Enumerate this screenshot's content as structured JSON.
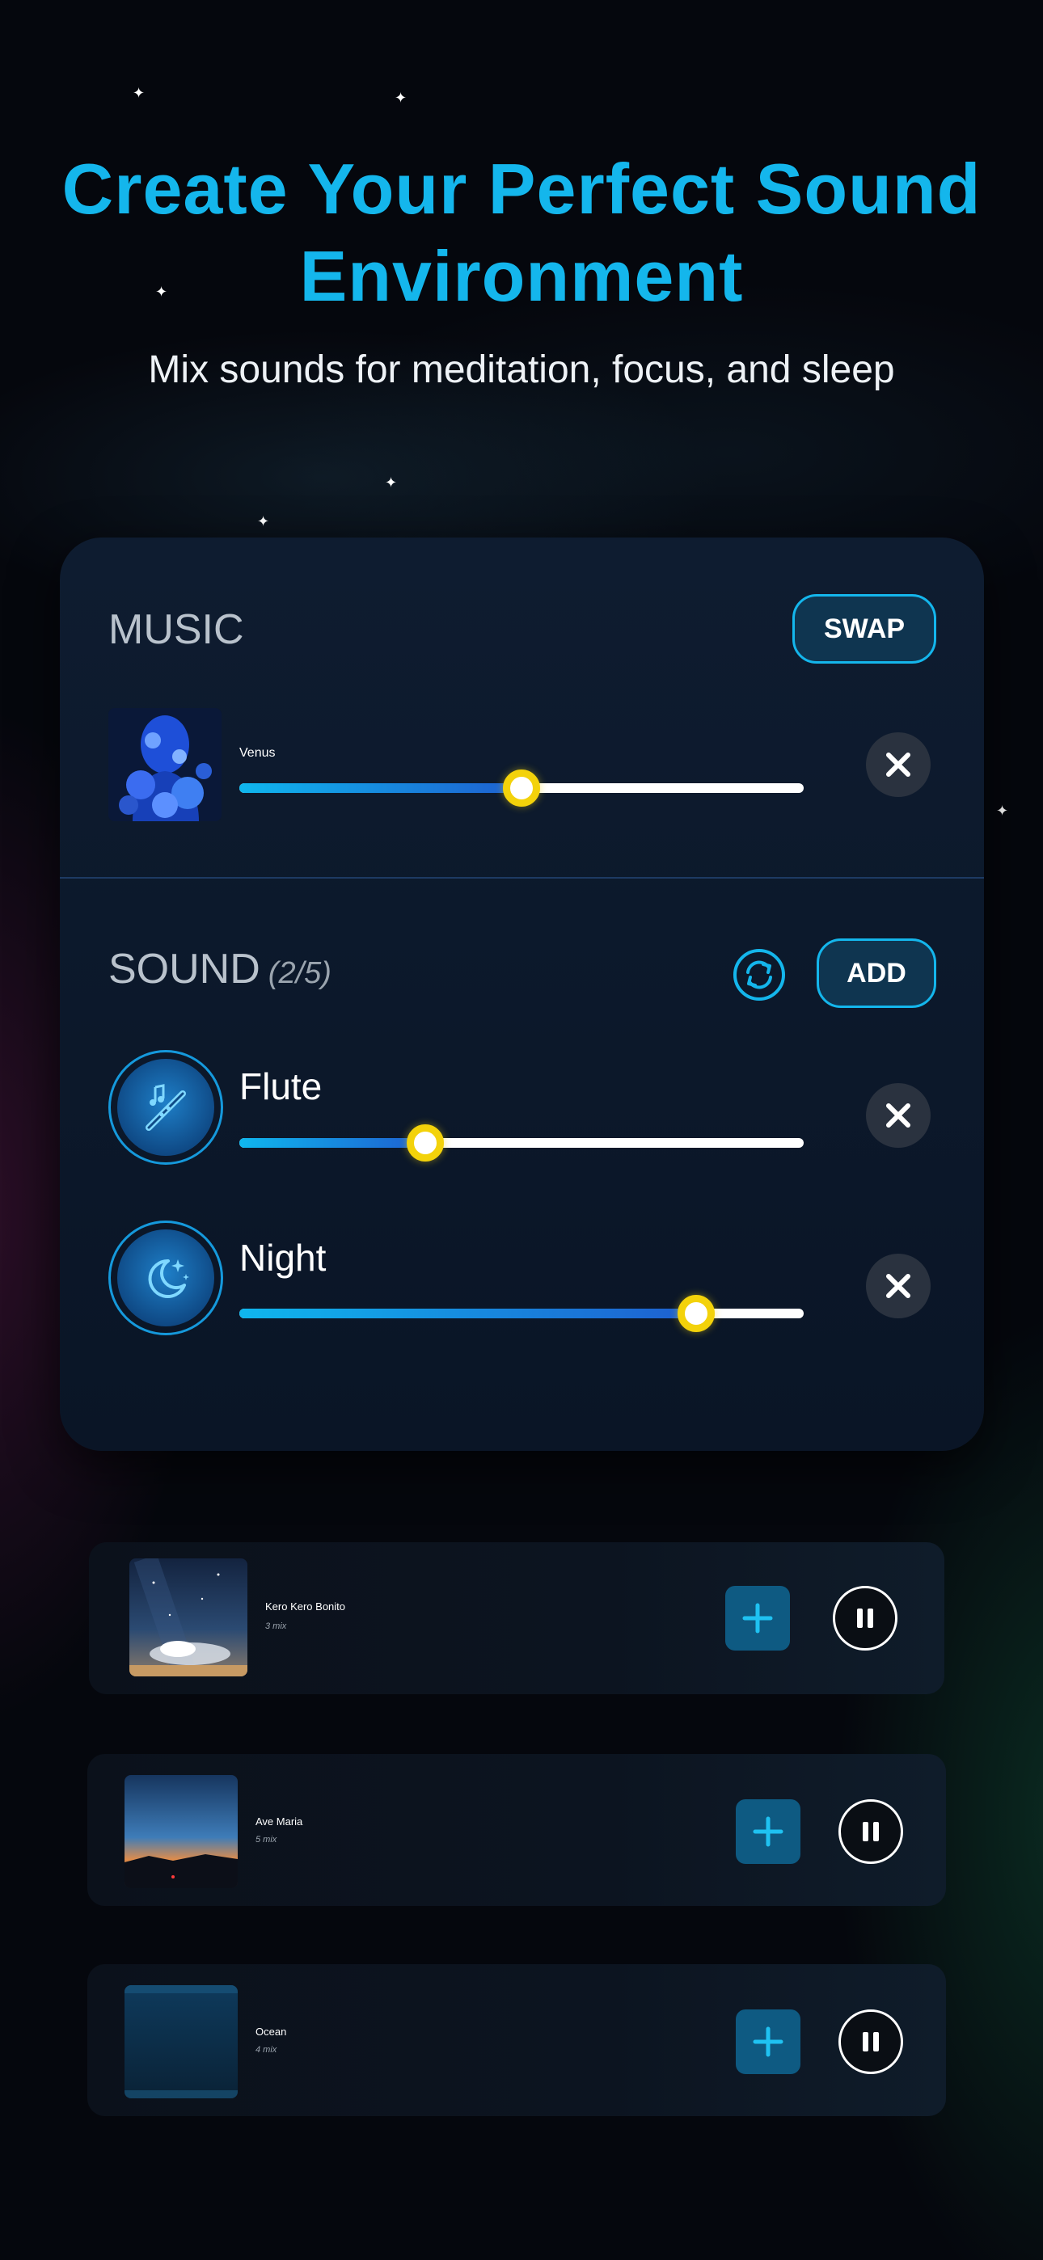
{
  "hero": {
    "title": "Create Your Perfect Sound Environment",
    "subtitle": "Mix sounds for meditation, focus, and sleep"
  },
  "music": {
    "section_title": "MUSIC",
    "swap_label": "SWAP",
    "track": {
      "name": "Venus",
      "volume_pct": 50
    }
  },
  "sound": {
    "section_title": "SOUND",
    "count": "(2/5)",
    "add_label": "ADD",
    "items": [
      {
        "name": "Flute",
        "icon": "flute-icon",
        "volume_pct": 33
      },
      {
        "name": "Night",
        "icon": "moon-stars-icon",
        "volume_pct": 81
      }
    ]
  },
  "mixes": [
    {
      "title": "Kero Kero Bonito",
      "subtitle": "3 mix"
    },
    {
      "title": "Ave Maria",
      "subtitle": "5 mix"
    },
    {
      "title": "Ocean",
      "subtitle": "4 mix"
    }
  ],
  "colors": {
    "accent": "#14b6ec",
    "slider_thumb": "#f3d20a",
    "panel": "#0e1c30",
    "background": "#05070d"
  }
}
